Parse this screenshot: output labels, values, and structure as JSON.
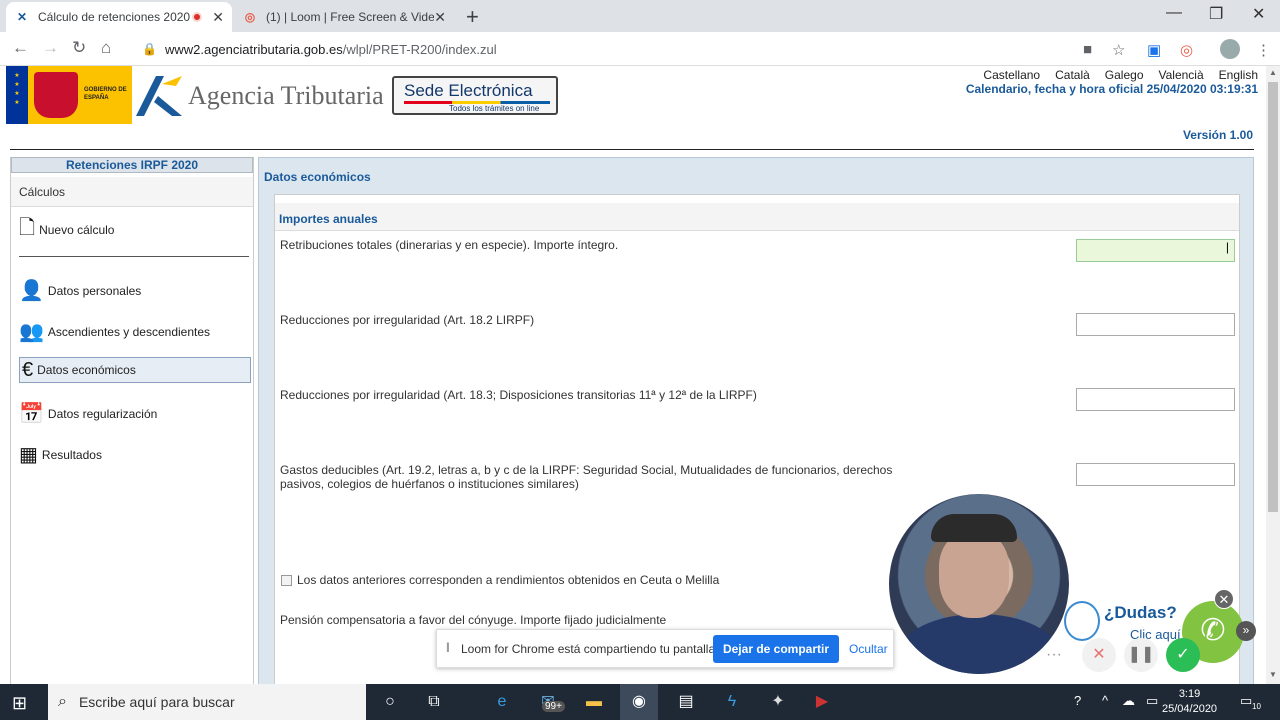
{
  "browser": {
    "tabs": [
      {
        "title": "Cálculo de retenciones 2020",
        "recording": true
      },
      {
        "title": "(1) | Loom | Free Screen & Video"
      }
    ],
    "new_tab": "+",
    "url_host": "www2.agenciatributaria.gob.es",
    "url_path": "/wlpl/PRET-R200/index.zul"
  },
  "header": {
    "gobierno": "GOBIERNO DE ESPAÑA",
    "agency": "Agencia Tributaria",
    "sede_title": "Sede Electrónica",
    "sede_sub": "Todos los trámites on line",
    "languages": [
      "Castellano",
      "Català",
      "Galego",
      "Valencià",
      "English"
    ],
    "calendar": "Calendario, fecha y hora oficial 25/04/2020 03:19:31",
    "version": "Versión 1.00"
  },
  "sidebar": {
    "title": "Retenciones IRPF 2020",
    "category": "Cálculos",
    "items": [
      {
        "label": "Nuevo cálculo",
        "icon": "document-icon"
      },
      {
        "label": "Datos personales",
        "icon": "person-icon"
      },
      {
        "label": "Ascendientes y descendientes",
        "icon": "group-icon"
      },
      {
        "label": "Datos económicos",
        "icon": "euro-icon",
        "active": true
      },
      {
        "label": "Datos regularización",
        "icon": "calendar-icon"
      },
      {
        "label": "Resultados",
        "icon": "calculator-icon"
      }
    ]
  },
  "main": {
    "title": "Datos económicos",
    "section": "Importes anuales",
    "fields": [
      {
        "label": "Retribuciones totales (dinerarias y en especie). Importe íntegro.",
        "value": "|"
      },
      {
        "label": "Reducciones por irregularidad (Art. 18.2 LIRPF)",
        "value": ""
      },
      {
        "label": "Reducciones por irregularidad (Art. 18.3; Disposiciones transitorias 11ª y 12ª de la LIRPF)",
        "value": ""
      },
      {
        "label": "Gastos deducibles (Art. 19.2, letras a, b y c de la LIRPF: Seguridad Social, Mutualidades de funcionarios, derechos pasivos, colegios de huérfanos o instituciones similares)",
        "value": ""
      }
    ],
    "checkbox": "Los datos anteriores corresponden a rendimientos obtenidos en Ceuta o Melilla",
    "pension": "Pensión compensatoria a favor del cónyuge. Importe fijado judicialmente"
  },
  "help": {
    "question": "¿Dudas?",
    "click": "Clic aquí"
  },
  "loom": {
    "message": "Loom for Chrome está compartiendo tu pantalla.",
    "stop": "Dejar de compartir",
    "hide": "Ocultar"
  },
  "taskbar": {
    "search": "Escribe aquí para buscar",
    "mail_badge": "99+",
    "time": "3:19",
    "date": "25/04/2020",
    "notifications": "10"
  },
  "colors": {
    "accent": "#1a5a9a",
    "loom_blue": "#1a73e8",
    "help_green": "#82c341",
    "focus_input": "#eaf7da"
  }
}
